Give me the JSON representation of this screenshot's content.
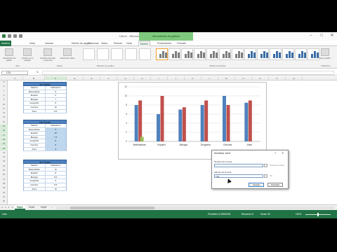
{
  "window": {
    "app_title": "Libro1 - Microsoft Excel",
    "context_tab": "Herramientas de gráficos"
  },
  "ribbon_tabs": [
    "Archivo",
    "Inicio",
    "Insertar",
    "Diseño de página",
    "Fórmulas",
    "Datos",
    "Revisar",
    "Vista",
    "Diseño",
    "Presentación",
    "Formato"
  ],
  "active_tab": "Diseño",
  "ribbon": {
    "groups": [
      "Tipo",
      "Datos",
      "Diseños de gráfico",
      "Estilos de diseño",
      "Ubicación"
    ],
    "buttons": [
      "Cambiar tipo de gráfico",
      "Guardar como plantilla",
      "Cambiar entre filas y columnas",
      "Seleccionar datos",
      "Mover gráfico"
    ]
  },
  "formula_bar": {
    "name_box": "C31",
    "fx": "fx"
  },
  "columns": [
    "A",
    "B",
    "C",
    "D",
    "E",
    "F",
    "G",
    "H",
    "I",
    "J",
    "K",
    "L",
    "M",
    "N",
    "O",
    "P",
    "Q"
  ],
  "selected_column": "C",
  "rows": [
    "5",
    "6",
    "7",
    "8",
    "9",
    "10",
    "11",
    "12",
    "13",
    "14",
    "15",
    "16",
    "17",
    "18",
    "19",
    "20",
    "21",
    "22",
    "23",
    "24",
    "25",
    "26",
    "27",
    "28",
    "29",
    "30",
    "31",
    "32"
  ],
  "tables": [
    {
      "title": "1er Parcial",
      "header": [
        "Materia",
        "Calificación"
      ],
      "rows": [
        [
          "Matemáticas",
          "8"
        ],
        [
          "Español",
          "6"
        ],
        [
          "Biología",
          "7"
        ],
        [
          "Geografía",
          "8"
        ],
        [
          "Ciencias",
          "10"
        ],
        [
          "Artes",
          "8.5"
        ]
      ]
    },
    {
      "title": "2do Parcial",
      "header": [
        "Materia",
        "Calificación"
      ],
      "rows": [
        [
          "Matemáticas",
          "9"
        ],
        [
          "Español",
          "10"
        ],
        [
          "Biología",
          "7.5"
        ],
        [
          "Geografía",
          "9"
        ],
        [
          "Ciencias",
          "8"
        ],
        [
          "Artes",
          "9"
        ]
      ]
    },
    {
      "title": "3er Parcial",
      "header": [
        "Materia",
        "Calificación"
      ],
      "rows": [
        [
          "Matemáticas",
          "10"
        ],
        [
          "Español",
          "8"
        ],
        [
          "Biología",
          "8.5"
        ],
        [
          "Geografía",
          "9"
        ],
        [
          "Ciencias",
          "8.5"
        ],
        [
          "Artes",
          "10"
        ]
      ]
    }
  ],
  "chart_data": {
    "type": "bar",
    "categories": [
      "Matemáticas",
      "Español",
      "Biología",
      "Geografía",
      "Ciencias",
      "Artes"
    ],
    "series": [
      {
        "values": [
          8,
          6,
          7,
          8,
          10,
          8.5
        ],
        "color": "#4f81bd"
      },
      {
        "values": [
          9,
          10,
          7.5,
          9,
          8,
          9
        ],
        "color": "#c0504d"
      },
      {
        "values": [
          1,
          0,
          0,
          0,
          0,
          0
        ],
        "color": "#9bbb59"
      }
    ],
    "ylim": [
      0,
      12
    ],
    "yticks": [
      "0",
      "2",
      "4",
      "6",
      "8",
      "10",
      "12"
    ],
    "grid": true
  },
  "dialog": {
    "title": "Modificar serie",
    "help": "?",
    "close": "✕",
    "name_label": "Nombre de la serie:",
    "name_hint": "Seleccionar rango",
    "values_label": "Valores de la serie:",
    "values_value": "={1}",
    "values_result": "= 1",
    "ok": "Aceptar",
    "cancel": "Cancelar"
  },
  "sheet_tabs": [
    "Hoja1",
    "Hoja2",
    "Hoja3"
  ],
  "active_sheet": "Hoja1",
  "status": {
    "ready": "Listo",
    "average": "Promedio: 8.33333333",
    "count": "Recuento: 6",
    "sum": "Suma: 50",
    "zoom": "100%"
  },
  "colors": {
    "excel_green": "#217346",
    "table_header": "#4f81bd"
  }
}
